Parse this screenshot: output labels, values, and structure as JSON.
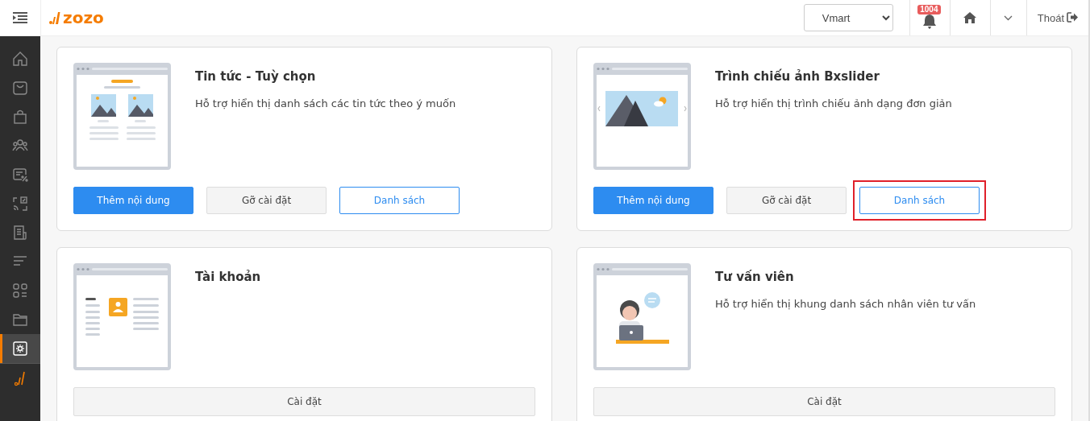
{
  "header": {
    "logo": "zozo",
    "store_select": {
      "value": "Vmart"
    },
    "notification_count": "1004",
    "logout": "Thoát"
  },
  "sidebar": {
    "items": [
      {
        "selected": false
      },
      {
        "selected": false
      },
      {
        "selected": false
      },
      {
        "selected": false
      },
      {
        "selected": false
      },
      {
        "selected": false
      },
      {
        "selected": false
      },
      {
        "selected": false
      },
      {
        "selected": false
      },
      {
        "selected": false
      },
      {
        "selected": true
      }
    ]
  },
  "modules": [
    {
      "title": "Tin tức - Tuỳ chọn",
      "description": "Hỗ trợ hiển thị danh sách các tin tức theo ý muốn",
      "buttons": [
        {
          "label": "Thêm nội dung",
          "kind": "primary",
          "highlighted": false
        },
        {
          "label": "Gỡ cài đặt",
          "kind": "default",
          "highlighted": false
        },
        {
          "label": "Danh sách",
          "kind": "outline",
          "highlighted": false
        }
      ]
    },
    {
      "title": "Trình chiếu ảnh Bxslider",
      "description": "Hỗ trợ hiển thị trình chiếu ảnh dạng đơn giản",
      "buttons": [
        {
          "label": "Thêm nội dung",
          "kind": "primary",
          "highlighted": false
        },
        {
          "label": "Gỡ cài đặt",
          "kind": "default",
          "highlighted": false
        },
        {
          "label": "Danh sách",
          "kind": "outline",
          "highlighted": true
        }
      ]
    },
    {
      "title": "Tài khoản",
      "buttons": [
        {
          "label": "Cài đặt",
          "kind": "wide",
          "highlighted": false
        }
      ]
    },
    {
      "title": "Tư vấn viên",
      "description": "Hỗ trợ hiển thị khung danh sách nhân viên tư vấn",
      "buttons": [
        {
          "label": "Cài đặt",
          "kind": "wide",
          "highlighted": false
        }
      ]
    }
  ]
}
